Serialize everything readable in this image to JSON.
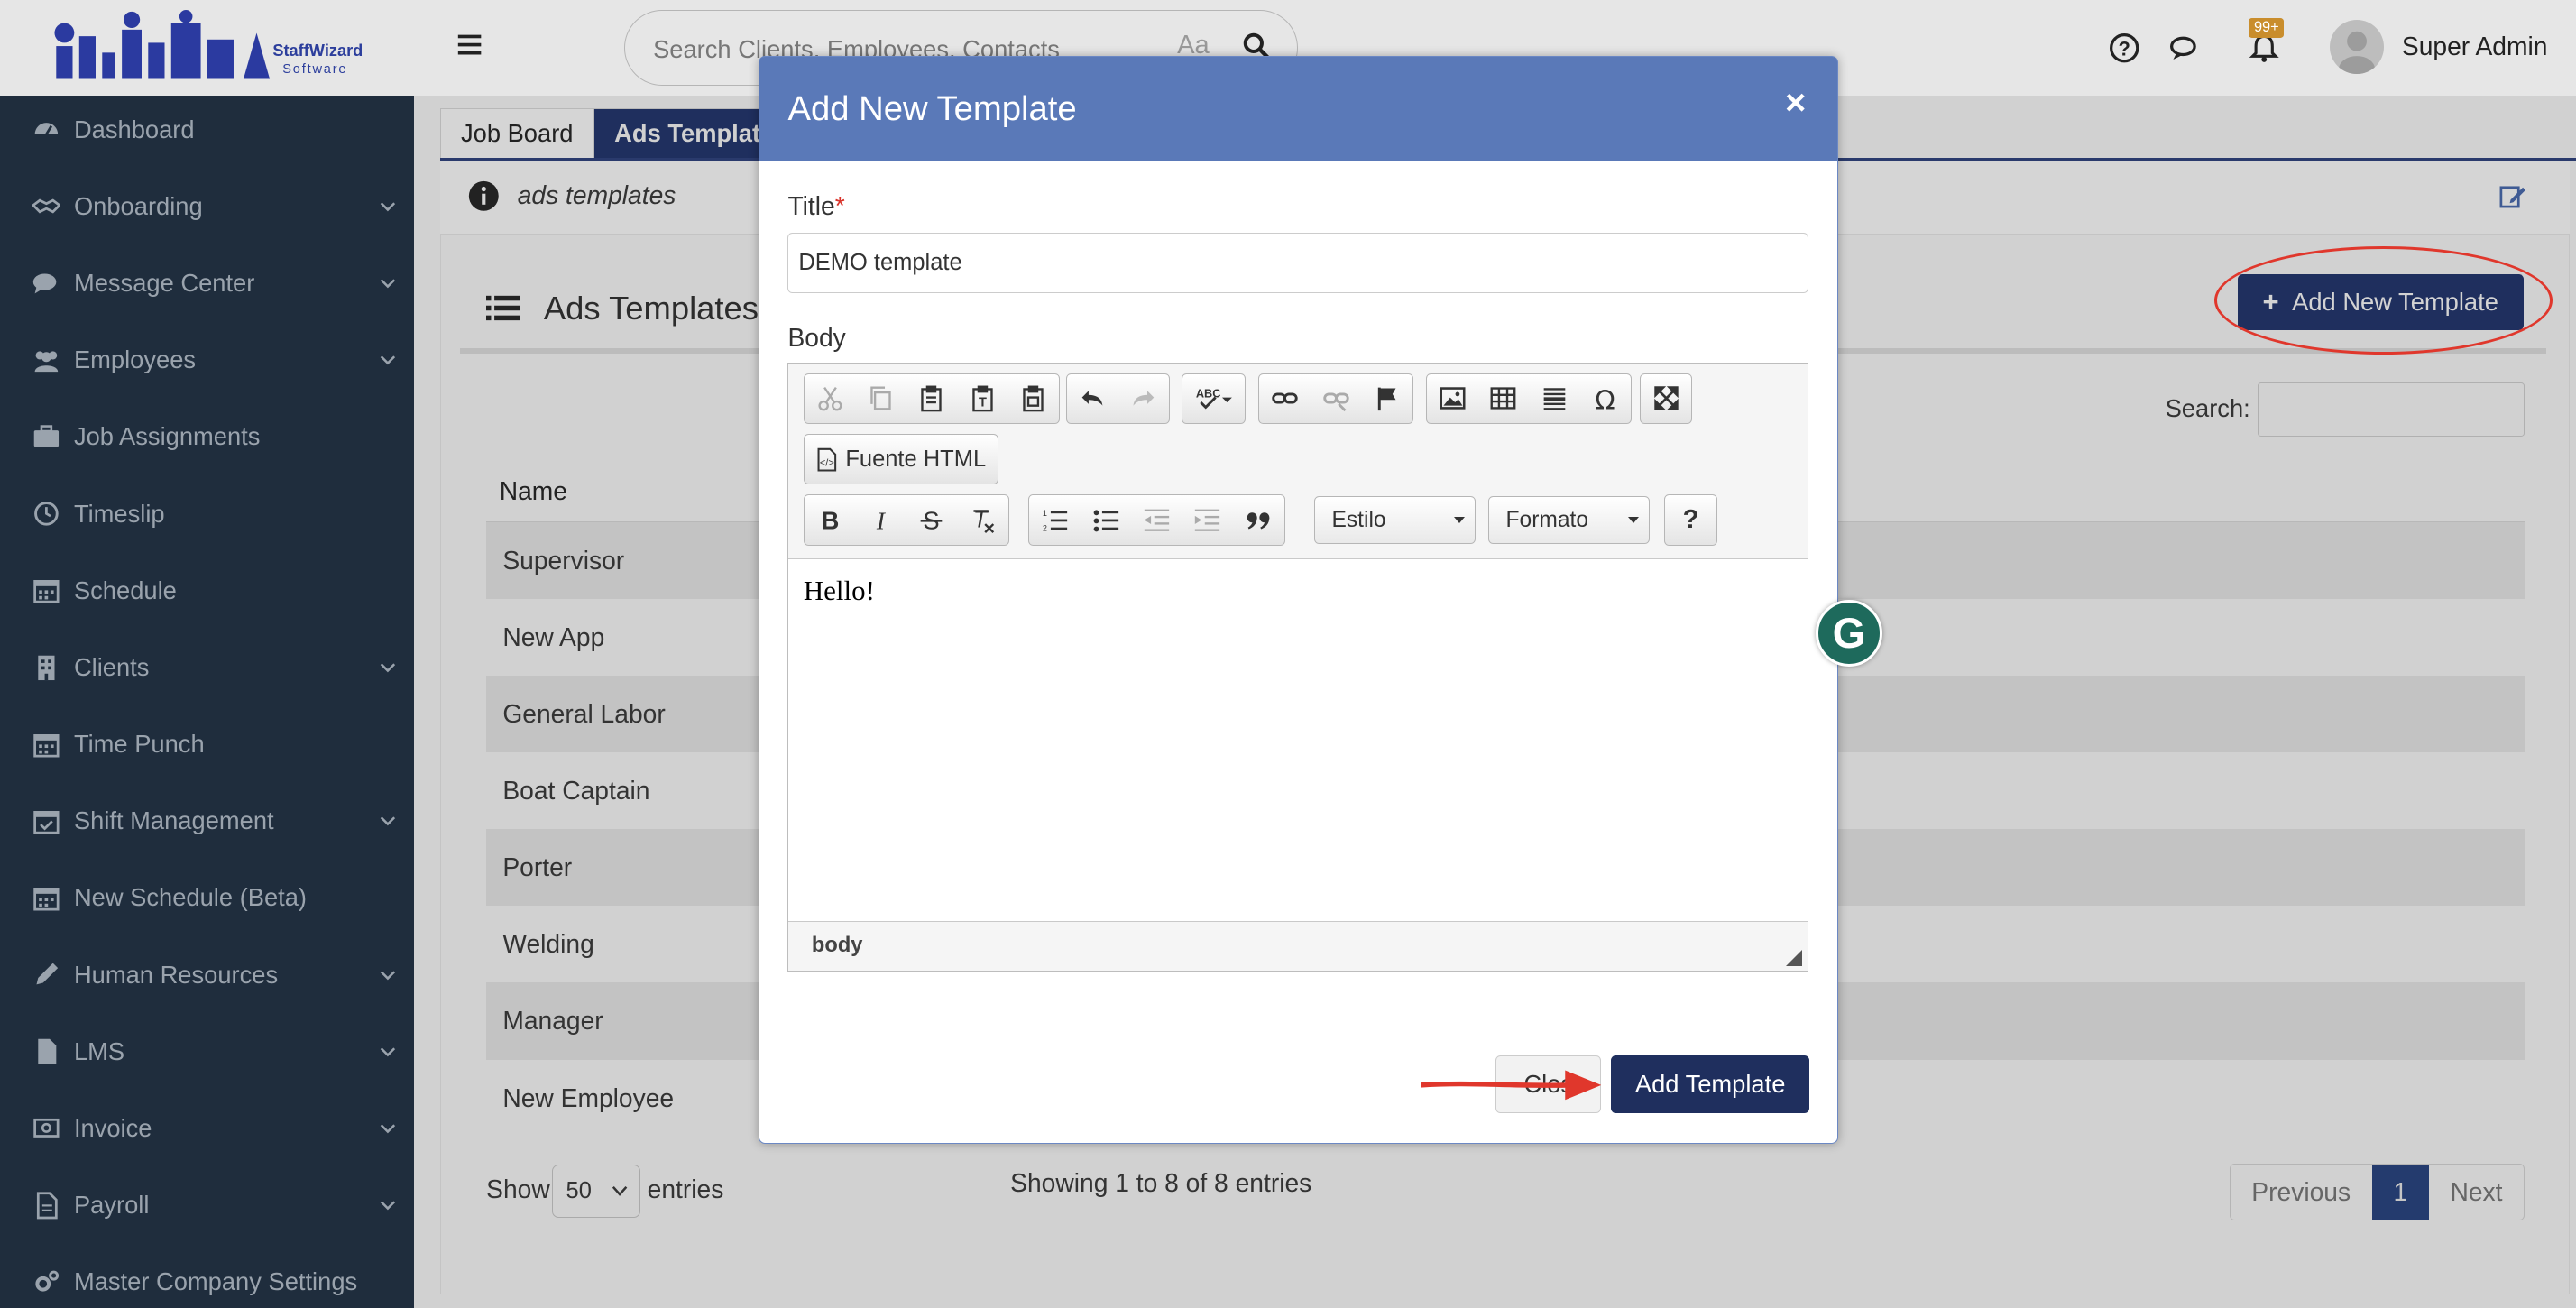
{
  "brand": {
    "name_line1": "StaffWizard",
    "name_line2": "Software"
  },
  "topbar": {
    "search_placeholder": "Search Clients, Employees, Contacts",
    "search_case": "Aa",
    "notifications_badge": "99+",
    "user_name": "Super Admin"
  },
  "sidebar": {
    "items": [
      {
        "label": "Dashboard",
        "icon": "dashboard-icon",
        "has_children": false
      },
      {
        "label": "Onboarding",
        "icon": "handshake-icon",
        "has_children": true
      },
      {
        "label": "Message Center",
        "icon": "comments-icon",
        "has_children": true
      },
      {
        "label": "Employees",
        "icon": "users-icon",
        "has_children": true
      },
      {
        "label": "Job Assignments",
        "icon": "briefcase-icon",
        "has_children": false
      },
      {
        "label": "Timeslip",
        "icon": "clock-icon",
        "has_children": false
      },
      {
        "label": "Schedule",
        "icon": "calendar-icon",
        "has_children": false
      },
      {
        "label": "Clients",
        "icon": "building-icon",
        "has_children": true
      },
      {
        "label": "Time Punch",
        "icon": "calendar-icon",
        "has_children": false
      },
      {
        "label": "Shift Management",
        "icon": "calendar-check-icon",
        "has_children": true
      },
      {
        "label": "New Schedule (Beta)",
        "icon": "calendar-icon",
        "has_children": false
      },
      {
        "label": "Human Resources",
        "icon": "pencil-icon",
        "has_children": true
      },
      {
        "label": "LMS",
        "icon": "file-icon",
        "has_children": true
      },
      {
        "label": "Invoice",
        "icon": "money-icon",
        "has_children": true
      },
      {
        "label": "Payroll",
        "icon": "file-text-icon",
        "has_children": true
      },
      {
        "label": "Master Company Settings",
        "icon": "gears-icon",
        "has_children": false
      }
    ]
  },
  "main": {
    "tabs": [
      {
        "label": "Job Board"
      },
      {
        "label": "Ads Templat"
      }
    ],
    "info_text": "ads templates",
    "card_title": "Ads Templates",
    "add_button_label": "Add New Template",
    "search_label": "Search:",
    "table": {
      "column_name": "Name",
      "rows": [
        "Supervisor",
        "New App",
        "General Labor",
        "Boat Captain",
        "Porter",
        "Welding",
        "Manager",
        "New Employee"
      ]
    },
    "show_label": "Show",
    "page_size": "50",
    "entries_label": "entries",
    "showing_text": "Showing 1 to 8 of 8 entries",
    "pager": {
      "previous": "Previous",
      "current": "1",
      "next": "Next"
    }
  },
  "modal": {
    "title": "Add New Template",
    "close_symbol": "×",
    "title_label": "Title",
    "required_mark": "*",
    "title_value": "DEMO template",
    "body_label": "Body",
    "editor": {
      "source_button": "Fuente HTML",
      "style_combo": "Estilo",
      "format_combo": "Formato",
      "help": "?",
      "content_text": "Hello!",
      "path": "body"
    },
    "close_button": "Close",
    "close_button_visible": "Clos",
    "submit_button": "Add Template"
  },
  "colors": {
    "sidebar_bg": "#1f2d3d",
    "modal_header": "#5a79b8",
    "primary_button": "#1f2f5e",
    "annotation_red": "#e0372c"
  }
}
